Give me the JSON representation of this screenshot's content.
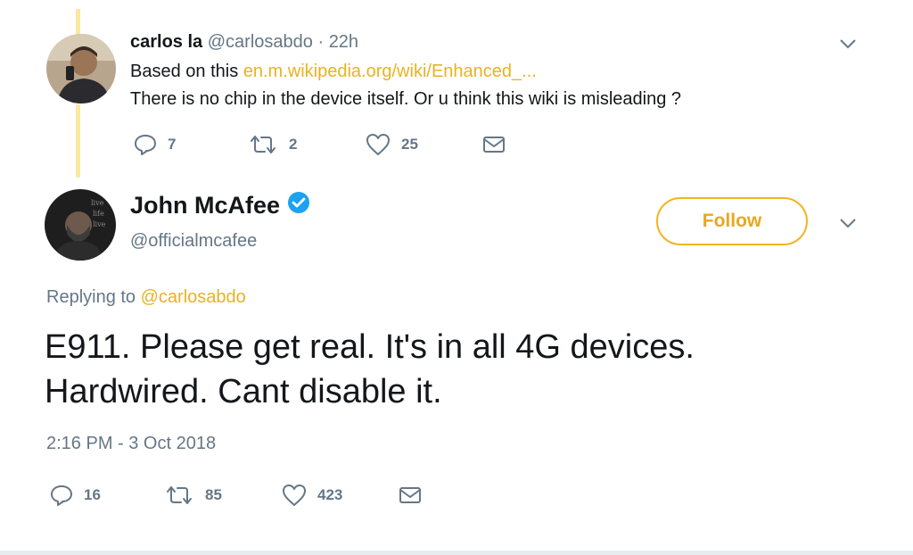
{
  "reply": {
    "display_name": "carlos la",
    "handle": "@carlosabdo",
    "time_sep": "·",
    "time": "22h",
    "text_prefix": "Based on this ",
    "link": "en.m.wikipedia.org/wiki/Enhanced_...",
    "text_line2": "There is no chip in the device itself. Or u think this wiki is misleading ?",
    "actions": {
      "replies": "7",
      "retweets": "2",
      "likes": "25"
    }
  },
  "tweet": {
    "display_name": "John McAfee",
    "handle": "@officialmcafee",
    "verified": true,
    "follow_label": "Follow",
    "replying_prefix": "Replying to ",
    "replying_handle": "@carlosabdo",
    "text_line1": "E911. Please get real. It's in all 4G devices.",
    "text_line2": "Hardwired. Cant disable it.",
    "timestamp": "2:16 PM - 3 Oct 2018",
    "actions": {
      "replies": "16",
      "retweets": "85",
      "likes": "423"
    }
  },
  "icons": {
    "reply": "reply-icon",
    "retweet": "retweet-icon",
    "like": "heart-icon",
    "message": "envelope-icon",
    "menu": "chevron-down-icon",
    "verified": "verified-badge-icon"
  },
  "colors": {
    "accent": "#f2b41e",
    "link": "#e8b223",
    "verified": "#1da1f2",
    "thread_line": "#fbe6a2",
    "muted": "#657786",
    "text": "#14171a"
  }
}
